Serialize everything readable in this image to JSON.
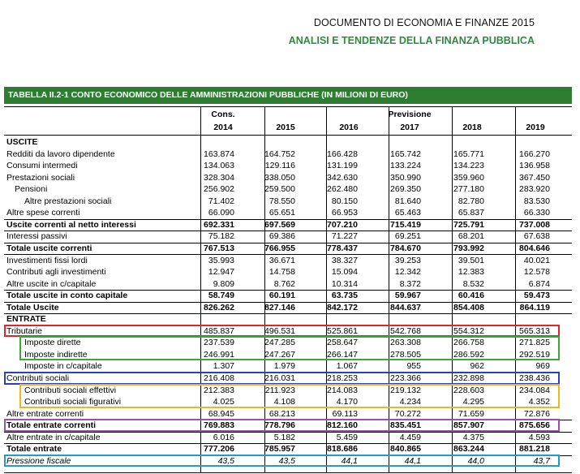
{
  "header": {
    "doc_title": "DOCUMENTO DI ECONOMIA E FINANZE 2015",
    "doc_subtitle": "ANALISI E TENDENZE DELLA FINANZA PUBBLICA"
  },
  "table": {
    "title": "TABELLA II.2-1   CONTO ECONOMICO DELLE AMMINISTRAZIONI PUBBLICHE (IN MILIONI DI EURO)",
    "col_group_cons": "Cons.",
    "col_group_prev": "Previsione",
    "years": [
      "2014",
      "2015",
      "2016",
      "2017",
      "2018",
      "2019"
    ],
    "rows": [
      {
        "label": "USCITE",
        "values": [
          "",
          "",
          "",
          "",
          "",
          ""
        ],
        "style": "section"
      },
      {
        "label": "Redditi da lavoro dipendente",
        "values": [
          "163.874",
          "164.752",
          "166.428",
          "165.742",
          "165.771",
          "166.270"
        ],
        "style": "normal"
      },
      {
        "label": "Consumi intermedi",
        "values": [
          "134.063",
          "129.116",
          "131.199",
          "133.224",
          "134.223",
          "136.958"
        ],
        "style": "normal"
      },
      {
        "label": "Prestazioni sociali",
        "values": [
          "328.304",
          "338.050",
          "342.630",
          "350.990",
          "359.960",
          "367.450"
        ],
        "style": "normal"
      },
      {
        "label": "Pensioni",
        "values": [
          "256.902",
          "259.500",
          "262.480",
          "269.350",
          "277.180",
          "283.920"
        ],
        "style": "indent1"
      },
      {
        "label": "Altre prestazioni sociali",
        "values": [
          "71.402",
          "78.550",
          "80.150",
          "81.640",
          "82.780",
          "83.530"
        ],
        "style": "indent2"
      },
      {
        "label": "Altre spese correnti",
        "values": [
          "66.090",
          "65.651",
          "66.953",
          "65.463",
          "65.837",
          "66.330"
        ],
        "style": "normal"
      },
      {
        "label": "Uscite correnti al netto interessi",
        "values": [
          "692.331",
          "697.569",
          "707.210",
          "715.419",
          "725.791",
          "737.008"
        ],
        "style": "bold"
      },
      {
        "label": "Interessi passivi",
        "values": [
          "75.182",
          "69.386",
          "71.227",
          "69.251",
          "68.201",
          "67.638"
        ],
        "style": "normal"
      },
      {
        "label": "Totale uscite correnti",
        "values": [
          "767.513",
          "766.955",
          "778.437",
          "784.670",
          "793.992",
          "804.646"
        ],
        "style": "bold"
      },
      {
        "label": "Investimenti fissi lordi",
        "values": [
          "35.993",
          "36.671",
          "38.327",
          "39.253",
          "39.501",
          "40.021"
        ],
        "style": "normal"
      },
      {
        "label": "Contributi agli investimenti",
        "values": [
          "12.947",
          "14.758",
          "15.094",
          "12.342",
          "12.383",
          "12.578"
        ],
        "style": "normal"
      },
      {
        "label": "Altre uscite in c/capitale",
        "values": [
          "9.809",
          "8.762",
          "10.314",
          "8.372",
          "8.532",
          "6.874"
        ],
        "style": "normal"
      },
      {
        "label": "Totale uscite in conto capitale",
        "values": [
          "58.749",
          "60.191",
          "63.735",
          "59.967",
          "60.416",
          "59.473"
        ],
        "style": "bold"
      },
      {
        "label": "Totale Uscite",
        "values": [
          "826.262",
          "827.146",
          "842.172",
          "844.637",
          "854.408",
          "864.119"
        ],
        "style": "bold"
      },
      {
        "label": "ENTRATE",
        "values": [
          "",
          "",
          "",
          "",
          "",
          ""
        ],
        "style": "section"
      },
      {
        "label": "Tributarie",
        "values": [
          "485.837",
          "496.531",
          "525.861",
          "542.768",
          "554.312",
          "565.313"
        ],
        "style": "normal"
      },
      {
        "label": "Imposte dirette",
        "values": [
          "237.539",
          "247.285",
          "258.647",
          "263.308",
          "266.758",
          "271.825"
        ],
        "style": "indent1"
      },
      {
        "label": "Imposte indirette",
        "values": [
          "246.991",
          "247.267",
          "266.147",
          "278.505",
          "286.592",
          "292.519"
        ],
        "style": "indent1"
      },
      {
        "label": "Imposte in c/capitale",
        "values": [
          "1.307",
          "1.979",
          "1.067",
          "955",
          "962",
          "969"
        ],
        "style": "indent1"
      },
      {
        "label": "Contributi sociali",
        "values": [
          "216.408",
          "216.031",
          "218.253",
          "223.366",
          "232.898",
          "238.436"
        ],
        "style": "normal"
      },
      {
        "label": "Contributi sociali effettivi",
        "values": [
          "212.383",
          "211.923",
          "214.083",
          "219.132",
          "228.603",
          "234.084"
        ],
        "style": "indent1"
      },
      {
        "label": "Contributi sociali figurativi",
        "values": [
          "4.025",
          "4.108",
          "4.170",
          "4.234",
          "4.295",
          "4.352"
        ],
        "style": "indent1"
      },
      {
        "label": "Altre entrate correnti",
        "values": [
          "68.945",
          "68.213",
          "69.113",
          "70.272",
          "71.659",
          "72.876"
        ],
        "style": "normal"
      },
      {
        "label": "Totale entrate correnti",
        "values": [
          "769.883",
          "778.796",
          "812.160",
          "835.451",
          "857.907",
          "875.656"
        ],
        "style": "bold"
      },
      {
        "label": "Altre entrate in c/capitale",
        "values": [
          "6.016",
          "5.182",
          "5.459",
          "4.459",
          "4.375",
          "4.593"
        ],
        "style": "normal"
      },
      {
        "label": "Totale entrate",
        "values": [
          "777.206",
          "785.957",
          "818.686",
          "840.865",
          "863.244",
          "881.218"
        ],
        "style": "bold"
      },
      {
        "label": "Pressione fiscale",
        "values": [
          "43,5",
          "43,5",
          "44,1",
          "44,1",
          "44,0",
          "43,7"
        ],
        "style": "italic"
      }
    ]
  },
  "highlight_colors": {
    "red": "#e0262b",
    "green": "#3aa935",
    "blue": "#2b3fc4",
    "yellow": "#f2b417",
    "purple": "#9b4fa8",
    "cyan": "#1e9bd6",
    "title_bar": "#2e7d32"
  }
}
